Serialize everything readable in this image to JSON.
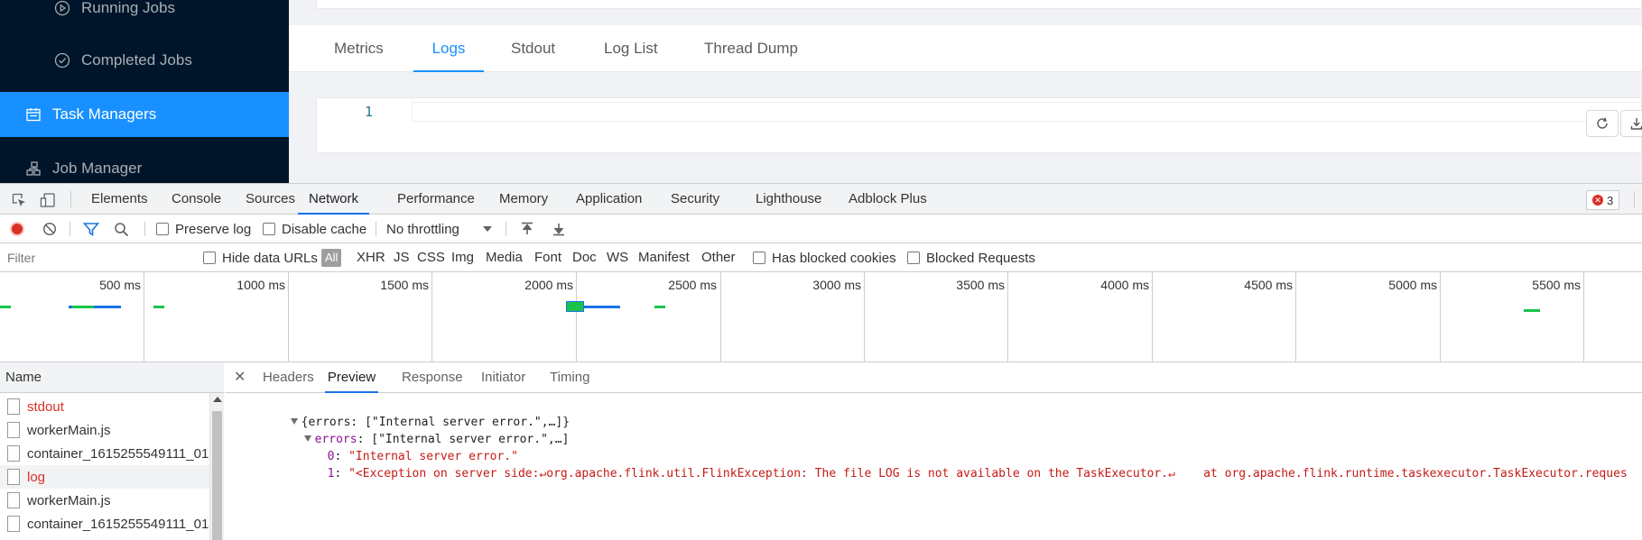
{
  "sidebar": {
    "items": [
      {
        "label": "Running Jobs",
        "icon": "play-circle-icon"
      },
      {
        "label": "Completed Jobs",
        "icon": "check-circle-icon"
      },
      {
        "label": "Task Managers",
        "icon": "calendar-icon",
        "active": true
      },
      {
        "label": "Job Manager",
        "icon": "cluster-icon"
      }
    ],
    "colors": {
      "background": "#001529",
      "active": "#1890ff"
    }
  },
  "flink_tabs": [
    "Metrics",
    "Logs",
    "Stdout",
    "Log List",
    "Thread Dump"
  ],
  "flink_active_tab": "Logs",
  "editor": {
    "line_number": "1",
    "buttons": [
      "reload-icon",
      "download-icon"
    ]
  },
  "devtools": {
    "tabs": [
      "Elements",
      "Console",
      "Sources",
      "Network",
      "Performance",
      "Memory",
      "Application",
      "Security",
      "Lighthouse",
      "Adblock Plus"
    ],
    "active_tab": "Network",
    "error_count": "3",
    "toolbar": {
      "preserve_log": "Preserve log",
      "disable_cache": "Disable cache",
      "throttling": "No throttling"
    },
    "filter": {
      "placeholder": "Filter",
      "hide_data_urls": "Hide data URLs",
      "types": [
        "All",
        "XHR",
        "JS",
        "CSS",
        "Img",
        "Media",
        "Font",
        "Doc",
        "WS",
        "Manifest",
        "Other"
      ],
      "active_type": "All",
      "has_blocked_cookies": "Has blocked cookies",
      "blocked_requests": "Blocked Requests"
    },
    "overview_ticks": [
      "500 ms",
      "1000 ms",
      "1500 ms",
      "2000 ms",
      "2500 ms",
      "3000 ms",
      "3500 ms",
      "4000 ms",
      "4500 ms",
      "5000 ms",
      "5500 ms"
    ],
    "name_header": "Name",
    "requests": [
      {
        "name": "stdout",
        "status": "error"
      },
      {
        "name": "workerMain.js",
        "status": "ok"
      },
      {
        "name": "container_1615255549111_01",
        "status": "ok"
      },
      {
        "name": "log",
        "status": "error",
        "selected": true
      },
      {
        "name": "workerMain.js",
        "status": "ok"
      },
      {
        "name": "container_1615255549111_01",
        "status": "ok"
      }
    ],
    "detail_tabs": [
      "Headers",
      "Preview",
      "Response",
      "Initiator",
      "Timing"
    ],
    "detail_active_tab": "Preview",
    "preview": {
      "root": "{errors: [\"Internal server error.\",…]}",
      "errors_key": "errors",
      "errors_summary": ": [\"Internal server error.\",…]",
      "item0_index": "0",
      "item0_value": "\"Internal server error.\"",
      "item1_index": "1",
      "item1_value": "\"<Exception on server side:↵org.apache.flink.util.FlinkException: The file LOG is not available on the TaskExecutor.↵    at org.apache.flink.runtime.taskexecutor.TaskExecutor.reques"
    }
  }
}
